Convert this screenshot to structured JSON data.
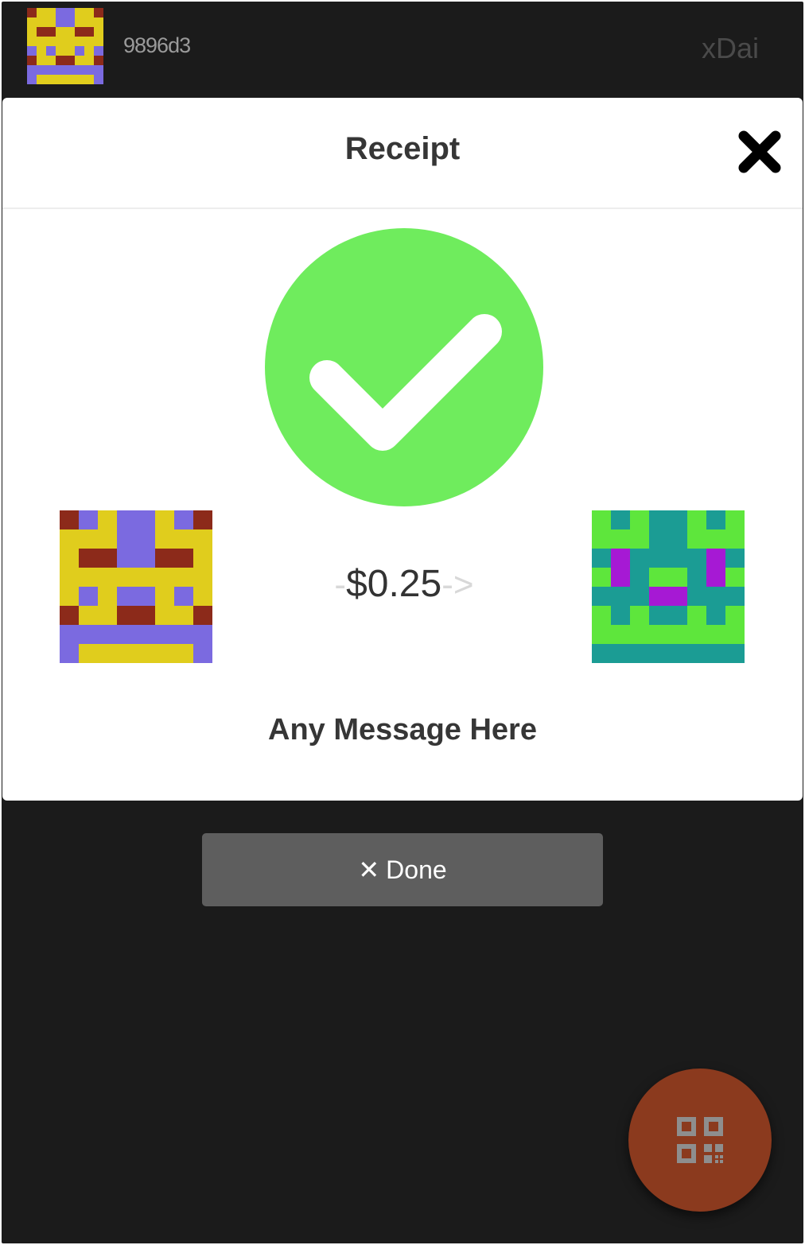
{
  "header": {
    "address": "9896d3",
    "network": "xDai"
  },
  "receipt": {
    "title": "Receipt",
    "close_icon": "close-icon",
    "status_icon": "check-circle-icon",
    "arrow_left": "-",
    "amount": "$0.25",
    "arrow_right": "->",
    "message": "Any Message Here",
    "success_color": "#6fec5d"
  },
  "done_button": {
    "icon": "✕",
    "label": "Done"
  },
  "fab": {
    "icon": "qr-code-icon",
    "color": "#8b3a1e"
  }
}
